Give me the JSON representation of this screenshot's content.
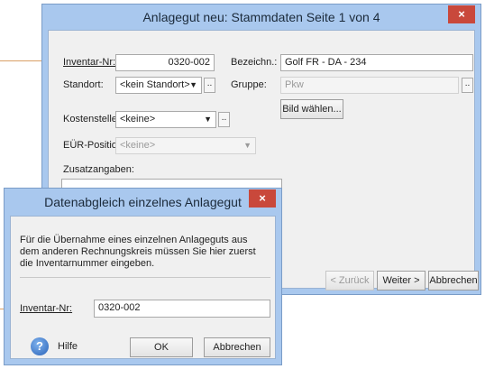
{
  "main_window": {
    "title": "Anlagegut neu: Stammdaten Seite 1 von 4",
    "close_glyph": "×",
    "inventar_nr": {
      "label": "Inventar-Nr:",
      "value": "0320-002"
    },
    "bezeichnung": {
      "label": "Bezeichn.:",
      "value": "Golf FR - DA - 234"
    },
    "standort": {
      "label": "Standort:",
      "value": "<kein Standort>",
      "lookup": ".."
    },
    "gruppe": {
      "label": "Gruppe:",
      "value": "Pkw",
      "lookup": ".."
    },
    "bild_waehlen": "Bild wählen...",
    "kostenstelle": {
      "label": "Kostenstelle:",
      "value": "<keine>",
      "lookup": ".."
    },
    "eur_position": {
      "label": "EÜR-Position:",
      "value": "<keine>"
    },
    "zusatzangaben": {
      "label": "Zusatzangaben:",
      "value": ""
    },
    "buttons": {
      "zurueck": "< Zurück",
      "weiter": "Weiter >",
      "abbrechen": "Abbrechen"
    }
  },
  "dialog": {
    "title": "Datenabgleich einzelnes Anlagegut",
    "close_glyph": "×",
    "message": "Für die Übernahme eines einzelnen Anlageguts aus dem anderen Rechnungskreis müssen Sie hier zuerst die Inventarnummer eingeben.",
    "inventar_nr": {
      "label": "Inventar-Nr:",
      "value": "0320-002"
    },
    "help_glyph": "?",
    "help_label": "Hilfe",
    "ok": "OK",
    "abbrechen": "Abbrechen"
  },
  "icons": {
    "dropdown": "chevron-down-icon",
    "help": "help-icon",
    "close": "close-icon"
  },
  "colors": {
    "titlebar": "#a9c8ee",
    "close": "#c9483b",
    "callout": "#d9a066"
  }
}
